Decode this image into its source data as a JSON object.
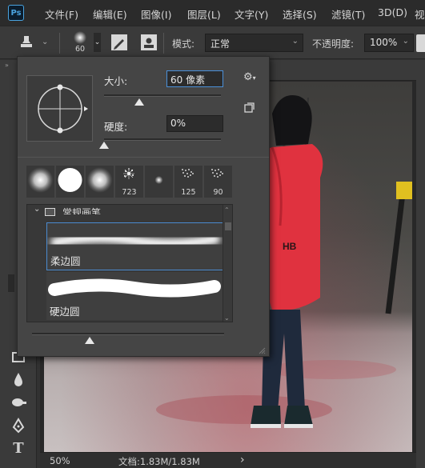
{
  "app": {
    "logo": "Ps"
  },
  "menu": [
    "文件(F)",
    "编辑(E)",
    "图像(I)",
    "图层(L)",
    "文字(Y)",
    "选择(S)",
    "滤镜(T)",
    "3D(D)",
    "视"
  ],
  "options": {
    "brush_size": "60",
    "mode_label": "模式:",
    "mode_value": "正常",
    "opacity_label": "不透明度:",
    "opacity_value": "100%"
  },
  "brush_panel": {
    "size_label": "大小:",
    "size_value": "60 像素",
    "size_fraction": 0.3,
    "hardness_label": "硬度:",
    "hardness_value": "0%",
    "hardness_fraction": 0.0,
    "presets": [
      {
        "kind": "soft-round",
        "count": ""
      },
      {
        "kind": "hard-round",
        "count": ""
      },
      {
        "kind": "soft-round",
        "count": ""
      },
      {
        "kind": "splatter",
        "count": "723"
      },
      {
        "kind": "small-dot",
        "count": ""
      },
      {
        "kind": "spray",
        "count": "125"
      },
      {
        "kind": "spray",
        "count": "90"
      }
    ],
    "folder_name": "常规画笔",
    "brushes": [
      {
        "name": "柔边圆",
        "style": "soft",
        "selected": true
      },
      {
        "name": "硬边圆",
        "style": "hard",
        "selected": false
      }
    ],
    "preview_fraction": 0.3
  },
  "status": {
    "zoom": "50%",
    "doc_info": "文档:1.83M/1.83M",
    "arrow": "›"
  },
  "colors": {
    "accent": "#4a90d9",
    "jacket": "#e0323f"
  }
}
